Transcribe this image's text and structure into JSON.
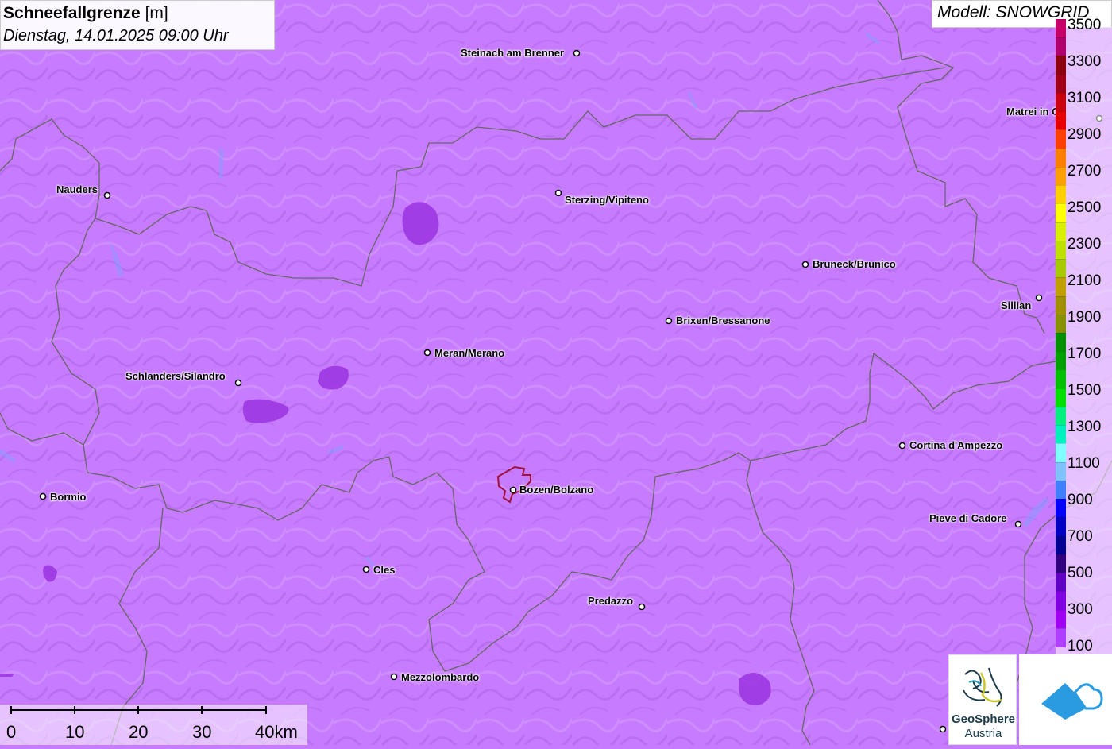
{
  "header": {
    "title_bold": "Schneefallgrenze",
    "title_unit": " [m]",
    "datetime": "Dienstag, 14.01.2025 09:00 Uhr",
    "model": "Modell: SNOWGRID"
  },
  "legend": {
    "labels": [
      "3500",
      "3300",
      "3100",
      "2900",
      "2700",
      "2500",
      "2300",
      "2100",
      "1900",
      "1700",
      "1500",
      "1300",
      "1100",
      "900",
      "700",
      "500",
      "300",
      "100"
    ],
    "colors": [
      "#c8006a",
      "#b0006e",
      "#8c0010",
      "#a0001a",
      "#c80010",
      "#e80000",
      "#ff4000",
      "#ff8000",
      "#ffa000",
      "#ffd000",
      "#ffff00",
      "#d8f000",
      "#c0e000",
      "#a8c800",
      "#c0a000",
      "#a09000",
      "#889000",
      "#009000",
      "#00a000",
      "#00c000",
      "#00e000",
      "#00f080",
      "#00f0c0",
      "#80ffff",
      "#80c0ff",
      "#4080ff",
      "#0000ff",
      "#0000c0",
      "#000090",
      "#300080",
      "#6000c0",
      "#8000e0",
      "#a000f0",
      "#b040ff"
    ]
  },
  "cities": [
    {
      "name": "Steinach am Brenner"
    },
    {
      "name": "Nauders"
    },
    {
      "name": "Sterzing/Vipiteno"
    },
    {
      "name": "Bruneck/Brunico"
    },
    {
      "name": "Sillian"
    },
    {
      "name": "Brixen/Bressanone"
    },
    {
      "name": "Meran/Merano"
    },
    {
      "name": "Schlanders/Silandro"
    },
    {
      "name": "Cortina d'Ampezzo"
    },
    {
      "name": "Bormio"
    },
    {
      "name": "Bozen/Bolzano"
    },
    {
      "name": "Pieve di Cadore"
    },
    {
      "name": "Cles"
    },
    {
      "name": "Predazzo"
    },
    {
      "name": "Mezzolombardo"
    },
    {
      "name": "Matrei in Osttirol"
    }
  ],
  "scale": {
    "labels": [
      "0",
      "10",
      "20",
      "30",
      "40km"
    ]
  },
  "logos": {
    "geosphere_line1": "GeoSphere",
    "geosphere_line2": "Austria"
  },
  "colors": {
    "background": "#c77bff",
    "border": "#555555",
    "blob": "#9a33e0",
    "bolzano_outline": "#a0103a"
  }
}
